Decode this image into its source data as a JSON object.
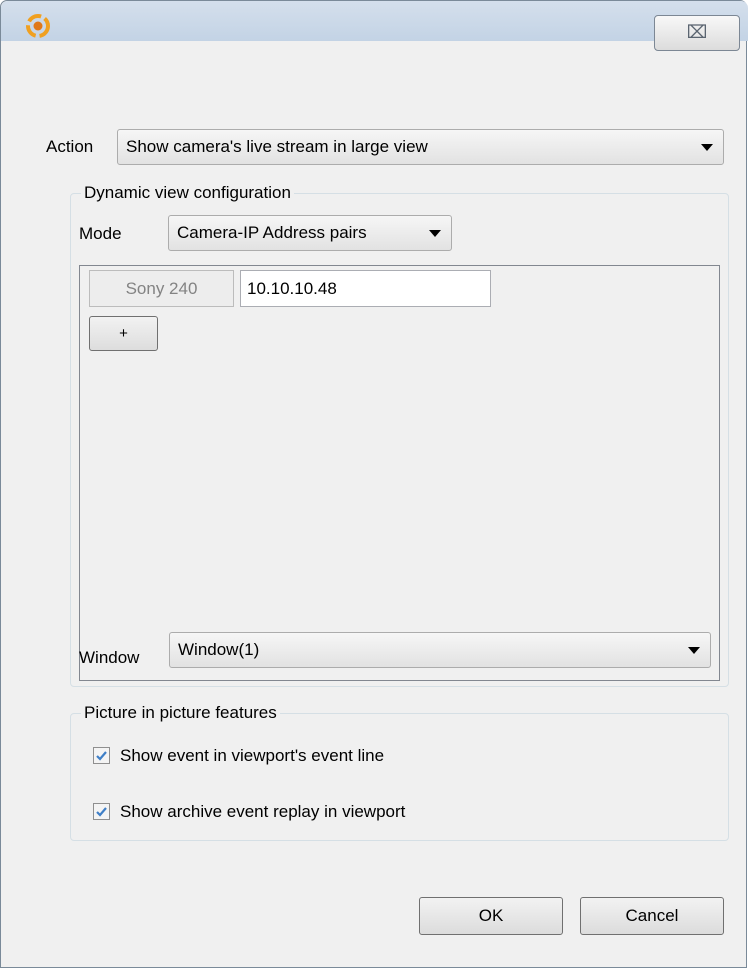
{
  "window": {
    "close_symbol": "⌧",
    "accent_color": "#3f7fc7"
  },
  "action": {
    "label": "Action",
    "value": "Show camera's live stream in large view"
  },
  "dynamic_view": {
    "title": "Dynamic view configuration",
    "mode_label": "Mode",
    "mode_value": "Camera-IP Address pairs",
    "pairs": [
      {
        "camera": "Sony 240",
        "ip": "10.10.10.48"
      }
    ],
    "add_label": "+",
    "window_label": "Window",
    "window_value": "Window(1)"
  },
  "pip": {
    "title": "Picture in picture features",
    "options": [
      {
        "label": "Show event in viewport's event line",
        "checked": true
      },
      {
        "label": "Show archive event replay in viewport",
        "checked": true
      }
    ]
  },
  "buttons": {
    "ok": "OK",
    "cancel": "Cancel"
  },
  "icons": [
    "app-logo-icon",
    "close-icon",
    "checkmark-icon",
    "dropdown-arrow-icon"
  ]
}
